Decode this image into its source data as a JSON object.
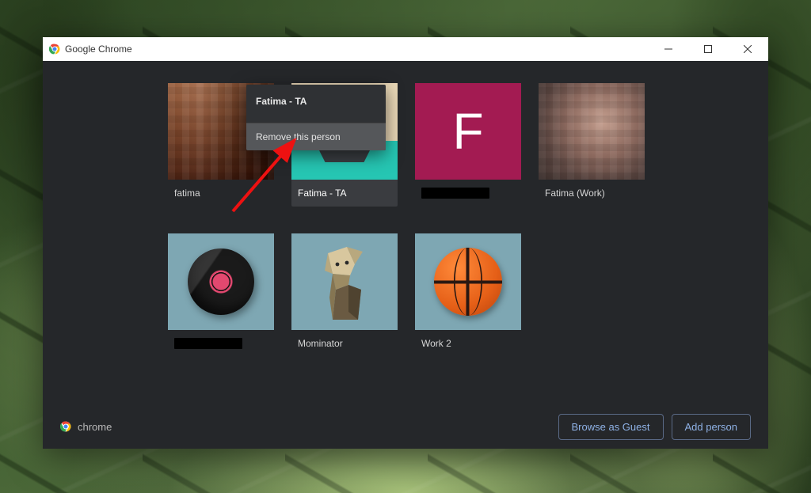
{
  "window": {
    "title": "Google Chrome"
  },
  "profiles": [
    {
      "label": "fatima",
      "redacted": false
    },
    {
      "label": "Fatima - TA",
      "redacted": false
    },
    {
      "label": "",
      "redacted": true
    },
    {
      "label": "Fatima (Work)",
      "redacted": false
    },
    {
      "label": "",
      "redacted": true
    },
    {
      "label": "Mominator",
      "redacted": false
    },
    {
      "label": "Work 2",
      "redacted": false
    }
  ],
  "letter_avatar": "F",
  "context_menu": {
    "title": "Fatima - TA",
    "item_remove": "Remove this person"
  },
  "footer": {
    "brand": "chrome",
    "browse_guest": "Browse as Guest",
    "add_person": "Add person"
  }
}
